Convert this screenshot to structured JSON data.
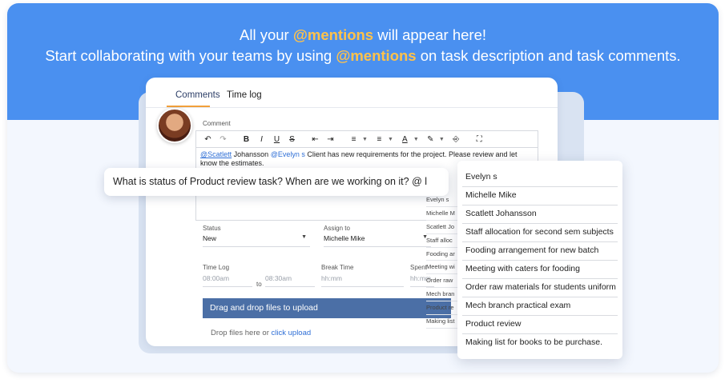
{
  "banner": {
    "line1_before": "All your ",
    "line1_highlight": "@mentions",
    "line1_after": " will appear here!",
    "line2_before": "Start collaborating with your teams by using ",
    "line2_highlight": "@mentions",
    "line2_after": " on task description and task comments."
  },
  "tabs": [
    {
      "label": "Comments",
      "active": true
    },
    {
      "label": "Time log",
      "active": false
    }
  ],
  "comment": {
    "label": "Comment",
    "mention1": "@Scatlett",
    "text1": " Johansson ",
    "mention2": "@Evelyn s",
    "text2": " Client has new requirements for the project. Please review and let know the estimates."
  },
  "toolbar": {
    "icons": [
      "undo-icon",
      "redo-icon",
      "bold-icon",
      "italic-icon",
      "underline-icon",
      "strikethrough-icon",
      "outdent-icon",
      "indent-icon",
      "ordered-list-icon",
      "unordered-list-icon",
      "text-color-icon",
      "highlight-icon",
      "clear-format-icon",
      "fullscreen-icon"
    ],
    "bold": "B",
    "italic": "I",
    "underline": "U",
    "strike": "S"
  },
  "form": {
    "status_label": "Status",
    "status_value": "New",
    "assign_label": "Assign to",
    "assign_value": "Michelle Mike",
    "timelog_label": "Time Log",
    "start_placeholder": "08:00am",
    "to_label": "to",
    "end_placeholder": "08:30am",
    "break_label": "Break Time",
    "break_placeholder": "hh:mm",
    "spent_label": "Spent",
    "spent_placeholder": "hh:mm"
  },
  "upload": {
    "bar_label": "Drag and drop files to upload",
    "drop_text": "Drop files here or ",
    "drop_link": "click upload"
  },
  "bubble": {
    "text": "What is status of Product review task? When are we working on it? @ l"
  },
  "mini_list": [
    "Evelyn s",
    "Michelle M",
    "Scatlett Jo",
    "Staff alloc",
    "Fooding ar",
    "Meeting wi",
    "Order raw",
    "Mech bran",
    "Product re",
    "Making list"
  ],
  "suggestions": [
    "Evelyn s",
    "Michelle Mike",
    "Scatlett Johansson",
    "Staff allocation for second sem subjects",
    "Fooding arrangement for new batch",
    "Meeting with caters for fooding",
    "Order raw materials for students uniform",
    "Mech branch practical exam",
    "Product review",
    "Making list for books to be purchase."
  ],
  "colors": {
    "banner": "#4a90f0",
    "highlight": "#ffc24a",
    "tab_underline": "#f2a03a",
    "upload_bar": "#4b6fa6",
    "link": "#2f6fd6"
  }
}
